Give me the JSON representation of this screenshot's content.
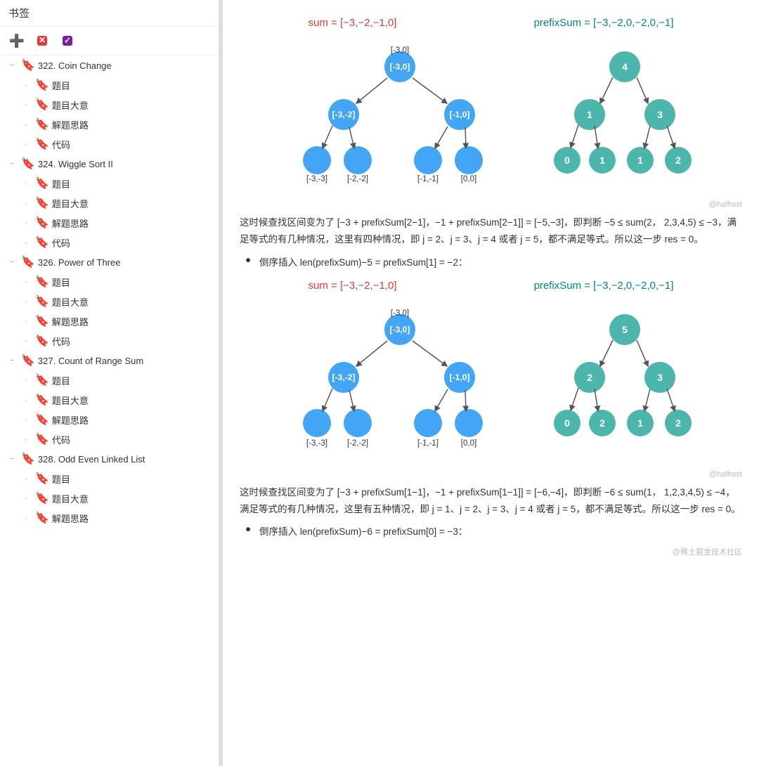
{
  "sidebar": {
    "header": "书签",
    "toolbar": {
      "add_icon": "+",
      "del_icon": "✕",
      "edit_icon": "✓"
    },
    "items": [
      {
        "id": "322",
        "label": "322. Coin Change",
        "level": 0,
        "collapsed": false,
        "children": [
          {
            "label": "题目",
            "level": 1
          },
          {
            "label": "题目大意",
            "level": 1
          },
          {
            "label": "解题思路",
            "level": 1
          },
          {
            "label": "代码",
            "level": 1
          }
        ]
      },
      {
        "id": "324",
        "label": "324. Wiggle Sort II",
        "level": 0,
        "collapsed": false,
        "children": [
          {
            "label": "题目",
            "level": 1
          },
          {
            "label": "题目大意",
            "level": 1
          },
          {
            "label": "解题思路",
            "level": 1
          },
          {
            "label": "代码",
            "level": 1
          }
        ]
      },
      {
        "id": "326",
        "label": "326. Power of Three",
        "level": 0,
        "collapsed": false,
        "children": [
          {
            "label": "题目",
            "level": 1
          },
          {
            "label": "题目大意",
            "level": 1
          },
          {
            "label": "解题思路",
            "level": 1
          },
          {
            "label": "代码",
            "level": 1
          }
        ]
      },
      {
        "id": "327",
        "label": "327. Count of Range Sum",
        "level": 0,
        "collapsed": false,
        "children": [
          {
            "label": "题目",
            "level": 1
          },
          {
            "label": "题目大意",
            "level": 1
          },
          {
            "label": "解题思路",
            "level": 1
          },
          {
            "label": "代码",
            "level": 1
          }
        ]
      },
      {
        "id": "328",
        "label": "328. Odd Even Linked List",
        "level": 0,
        "collapsed": false,
        "children": [
          {
            "label": "题目",
            "level": 1
          },
          {
            "label": "题目大意",
            "level": 1
          },
          {
            "label": "解题思路",
            "level": 1
          }
        ]
      }
    ]
  },
  "main": {
    "section1": {
      "sum_label": "sum = [−3,−2,−1,0]",
      "prefix_label": "prefixSum = [−3,−2,0,−2,0,−1]",
      "desc1": "这时候查找区间变为了 [−3 + prefixSum[2−1]，−1 + prefixSum[2−1]] = [−5,−3]，即判断 −5 ≤ sum(2，  2,3,4,5) ≤ −3，满足等式的有几种情况，这里有四种情况，即 j = 2、j = 3、j = 4 或者 j = 5，都不满足等式。所以这一步 res = 0。",
      "bullet1": "倒序插入 len(prefixSum)−5 = prefixSum[1] = −2："
    },
    "section2": {
      "sum_label": "sum = [−3,−2,−1,0]",
      "prefix_label": "prefixSum = [−3,−2,0,−2,0,−1]",
      "desc2": "这时候查找区间变为了 [−3 + prefixSum[1−1]，−1 + prefixSum[1−1]] = [−6,−4]，即判断 −6 ≤ sum(1，  1,2,3,4,5) ≤ −4，满足等式的有几种情况，这里有五种情况，即 j = 1、j = 2、j = 3、j = 4 或者 j = 5，都不满足等式。所以这一步 res = 0。",
      "bullet2": "倒序插入 len(prefixSum)−6 = prefixSum[0] = −3："
    },
    "watermark1": "@halfrost",
    "watermark2": "@halfrost",
    "watermark3": "@稀土掘金技术社区"
  }
}
